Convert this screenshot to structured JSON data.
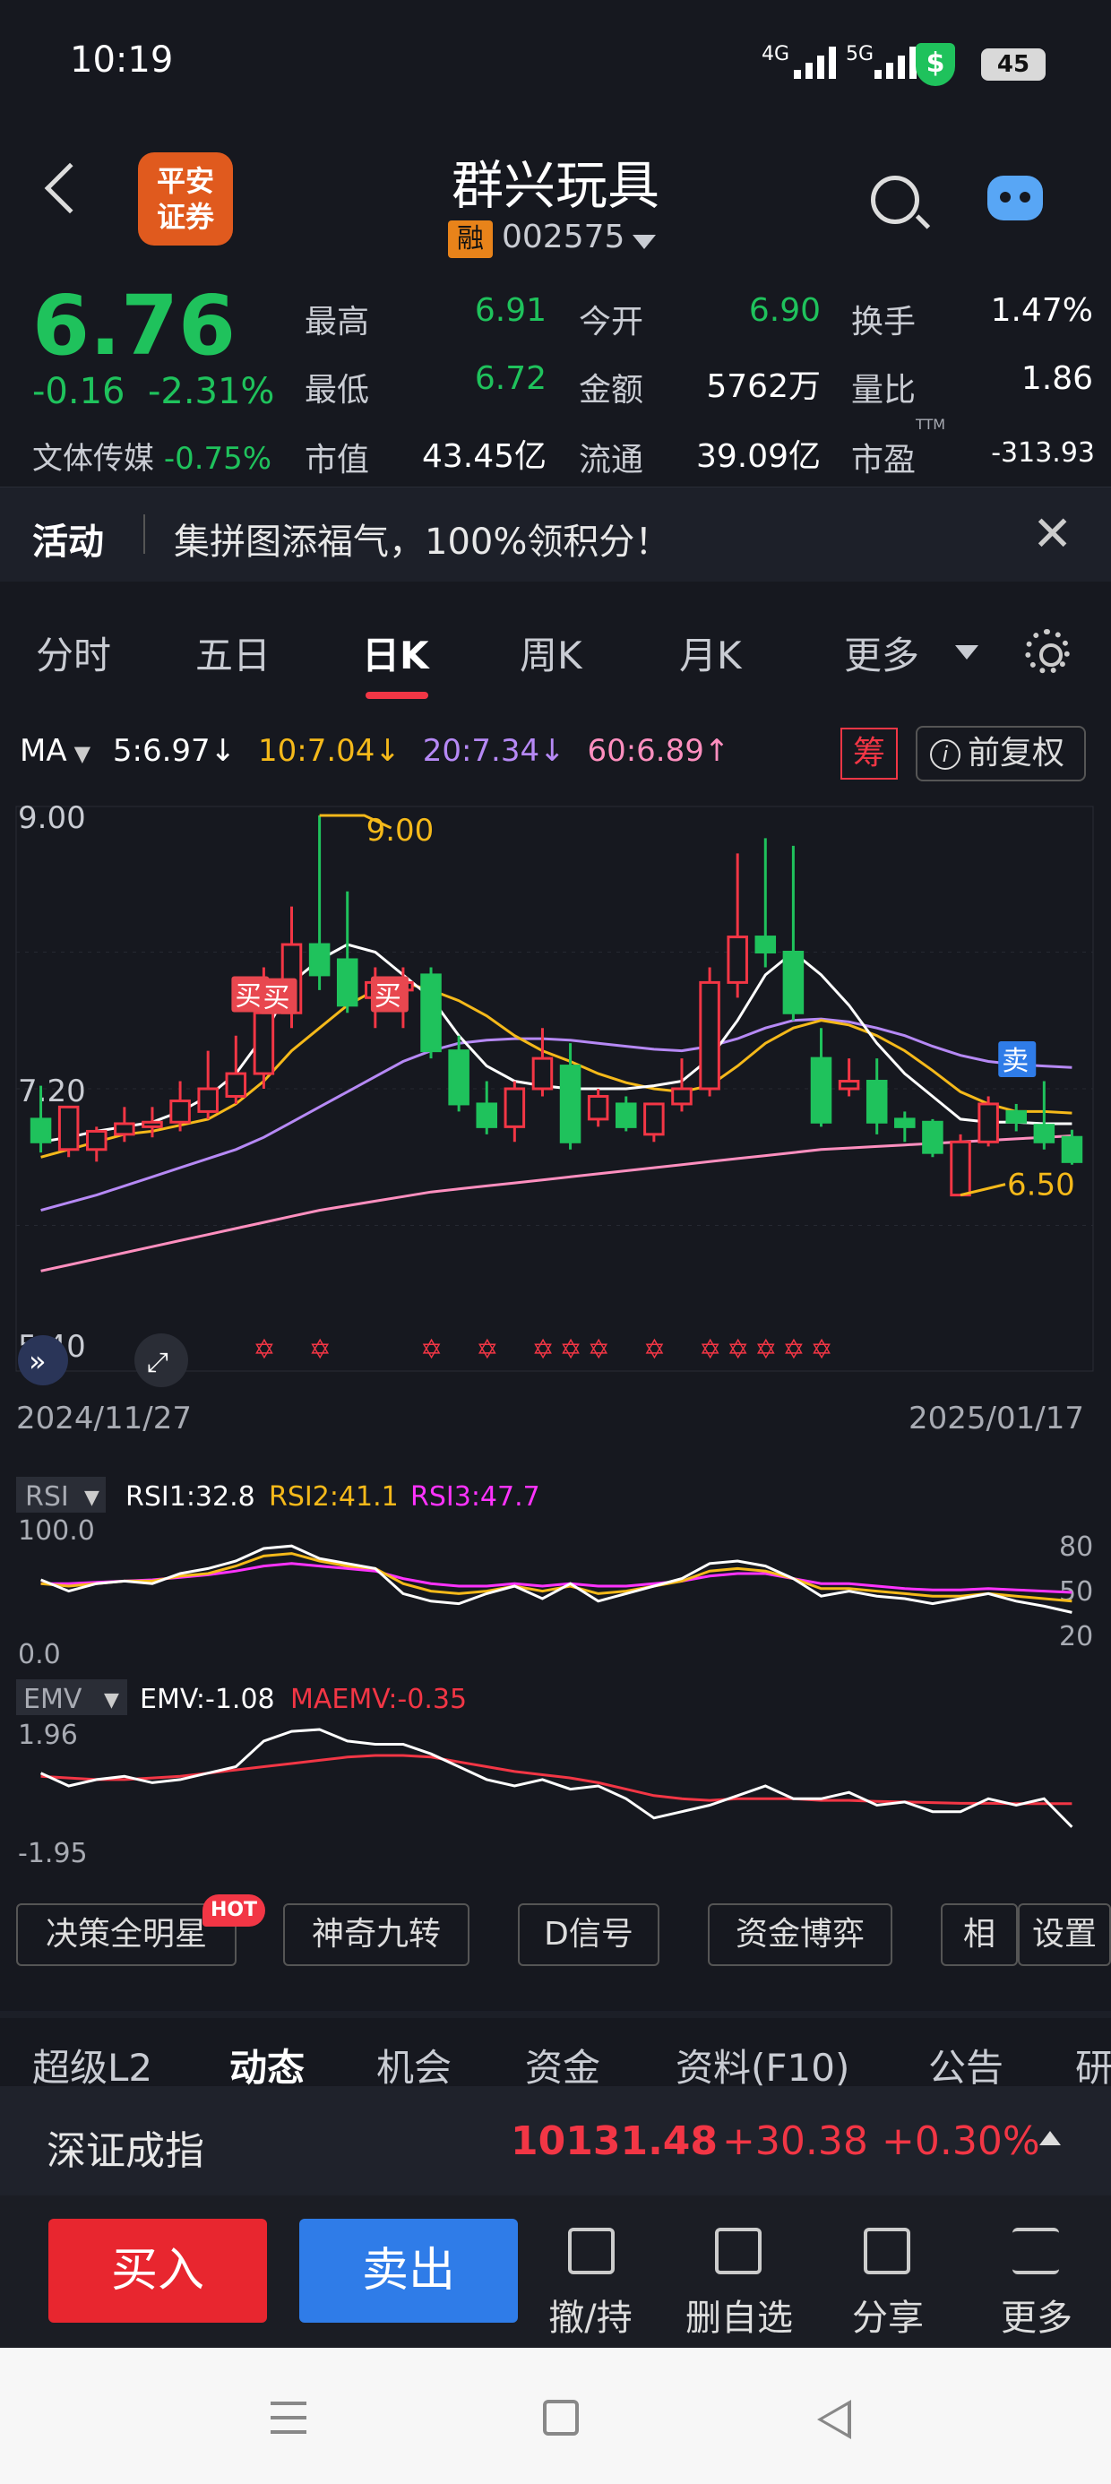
{
  "status_bar": {
    "time": "10:19",
    "net1": "4G",
    "net2": "5G",
    "vpn": "$",
    "battery": "45"
  },
  "header": {
    "logo": "平安\n证券",
    "logo_line1": "平安",
    "logo_line2": "证券",
    "title": "群兴玩具",
    "tag": "融",
    "code": "002575"
  },
  "quote": {
    "price": "6.76",
    "change": "-0.16",
    "change_pct": "-2.31%",
    "sector_label": "文体传媒",
    "sector_pct": "-0.75%",
    "fields": [
      {
        "label": "最高",
        "value": "6.91"
      },
      {
        "label": "今开",
        "value": "6.90"
      },
      {
        "label": "换手",
        "value": "1.47%"
      },
      {
        "label": "最低",
        "value": "6.72"
      },
      {
        "label": "金额",
        "value": "5762万"
      },
      {
        "label": "量比",
        "value": "1.86"
      },
      {
        "label": "市值",
        "value": "43.45亿"
      },
      {
        "label": "流通",
        "value": "39.09亿"
      },
      {
        "label": "市盈",
        "value": "-313.93"
      }
    ],
    "pe_suffix": "TTM"
  },
  "activity": {
    "label": "活动",
    "text": "集拼图添福气，100%领积分！"
  },
  "tabs": [
    "分时",
    "五日",
    "日K",
    "周K",
    "月K",
    "更多"
  ],
  "active_tab": "日K",
  "ma_line": {
    "label": "MA",
    "ma5": "5:6.97↓",
    "ma10": "10:7.04↓",
    "ma20": "20:7.34↓",
    "ma60": "60:6.89↑",
    "chou": "筹",
    "fuquan": "前复权",
    "info_icon": "i"
  },
  "chart_data": {
    "type": "candlestick",
    "y_labels": [
      "9.00",
      "7.20",
      "5.40"
    ],
    "ylim": [
      5.4,
      9.0
    ],
    "x_start": "2024/11/27",
    "x_end": "2025/01/17",
    "high_marker": "9.00",
    "low_marker": "6.50",
    "signals": [
      {
        "label": "买",
        "candle": 8
      },
      {
        "label": "买",
        "candle": 9
      },
      {
        "label": "买",
        "candle": 13
      },
      {
        "label": "卖",
        "candle": 35
      }
    ],
    "star_count": 14,
    "candles": [
      {
        "o": 7.0,
        "h": 7.22,
        "c": 6.85,
        "l": 6.78
      },
      {
        "o": 6.8,
        "h": 7.02,
        "c": 7.08,
        "l": 6.75
      },
      {
        "o": 6.8,
        "h": 6.95,
        "c": 6.92,
        "l": 6.72
      },
      {
        "o": 6.9,
        "h": 7.08,
        "c": 6.97,
        "l": 6.85
      },
      {
        "o": 6.95,
        "h": 7.08,
        "c": 6.98,
        "l": 6.88
      },
      {
        "o": 6.98,
        "h": 7.25,
        "c": 7.12,
        "l": 6.92
      },
      {
        "o": 7.05,
        "h": 7.45,
        "c": 7.2,
        "l": 7.0
      },
      {
        "o": 7.15,
        "h": 7.55,
        "c": 7.3,
        "l": 7.1
      },
      {
        "o": 7.3,
        "h": 8.0,
        "c": 7.7,
        "l": 7.2
      },
      {
        "o": 7.7,
        "h": 8.4,
        "c": 8.15,
        "l": 7.6
      },
      {
        "o": 8.15,
        "h": 9.0,
        "c": 7.95,
        "l": 7.85
      },
      {
        "o": 8.05,
        "h": 8.5,
        "c": 7.75,
        "l": 7.7
      },
      {
        "o": 7.8,
        "h": 8.0,
        "c": 7.9,
        "l": 7.6
      },
      {
        "o": 7.85,
        "h": 8.0,
        "c": 7.9,
        "l": 7.6
      },
      {
        "o": 7.95,
        "h": 8.0,
        "c": 7.45,
        "l": 7.4
      },
      {
        "o": 7.45,
        "h": 7.55,
        "c": 7.1,
        "l": 7.05
      },
      {
        "o": 7.1,
        "h": 7.25,
        "c": 6.95,
        "l": 6.9
      },
      {
        "o": 6.95,
        "h": 7.25,
        "c": 7.2,
        "l": 6.85
      },
      {
        "o": 7.2,
        "h": 7.6,
        "c": 7.4,
        "l": 7.15
      },
      {
        "o": 7.35,
        "h": 7.5,
        "c": 6.85,
        "l": 6.8
      },
      {
        "o": 7.0,
        "h": 7.2,
        "c": 7.15,
        "l": 6.95
      },
      {
        "o": 7.1,
        "h": 7.15,
        "c": 6.95,
        "l": 6.92
      },
      {
        "o": 6.9,
        "h": 7.1,
        "c": 7.1,
        "l": 6.85
      },
      {
        "o": 7.1,
        "h": 7.4,
        "c": 7.2,
        "l": 7.05
      },
      {
        "o": 7.2,
        "h": 8.0,
        "c": 7.9,
        "l": 7.15
      },
      {
        "o": 7.9,
        "h": 8.75,
        "c": 8.2,
        "l": 7.8
      },
      {
        "o": 8.2,
        "h": 8.85,
        "c": 8.1,
        "l": 8.0
      },
      {
        "o": 8.1,
        "h": 8.8,
        "c": 7.7,
        "l": 7.65
      },
      {
        "o": 7.4,
        "h": 7.6,
        "c": 6.98,
        "l": 6.95
      },
      {
        "o": 7.2,
        "h": 7.4,
        "c": 7.25,
        "l": 7.15
      },
      {
        "o": 7.25,
        "h": 7.4,
        "c": 6.98,
        "l": 6.9
      },
      {
        "o": 7.0,
        "h": 7.05,
        "c": 6.95,
        "l": 6.85
      },
      {
        "o": 6.98,
        "h": 7.0,
        "c": 6.78,
        "l": 6.75
      },
      {
        "o": 6.5,
        "h": 6.9,
        "c": 6.85,
        "l": 6.5
      },
      {
        "o": 6.85,
        "h": 7.15,
        "c": 7.1,
        "l": 6.82
      },
      {
        "o": 7.05,
        "h": 7.1,
        "c": 6.98,
        "l": 6.92
      },
      {
        "o": 6.96,
        "h": 7.25,
        "c": 6.85,
        "l": 6.8
      },
      {
        "o": 6.88,
        "h": 6.93,
        "c": 6.72,
        "l": 6.7
      }
    ],
    "ma5": [
      6.85,
      6.88,
      6.92,
      6.95,
      6.98,
      7.05,
      7.15,
      7.3,
      7.55,
      7.9,
      8.05,
      8.15,
      8.1,
      7.95,
      7.8,
      7.55,
      7.35,
      7.25,
      7.22,
      7.2,
      7.2,
      7.2,
      7.22,
      7.25,
      7.4,
      7.65,
      7.95,
      8.1,
      7.95,
      7.75,
      7.5,
      7.3,
      7.15,
      7.0,
      6.98,
      6.98,
      6.97,
      6.97
    ],
    "ma10": [
      6.75,
      6.8,
      6.85,
      6.9,
      6.92,
      6.96,
      7.0,
      7.1,
      7.25,
      7.45,
      7.6,
      7.75,
      7.85,
      7.9,
      7.85,
      7.78,
      7.68,
      7.55,
      7.45,
      7.38,
      7.3,
      7.24,
      7.2,
      7.18,
      7.22,
      7.35,
      7.5,
      7.6,
      7.65,
      7.62,
      7.55,
      7.45,
      7.32,
      7.18,
      7.1,
      7.05,
      7.05,
      7.04
    ],
    "ma20": [
      6.4,
      6.45,
      6.5,
      6.56,
      6.62,
      6.68,
      6.74,
      6.8,
      6.88,
      6.98,
      7.08,
      7.18,
      7.28,
      7.38,
      7.45,
      7.5,
      7.52,
      7.53,
      7.53,
      7.52,
      7.5,
      7.48,
      7.46,
      7.45,
      7.48,
      7.53,
      7.6,
      7.65,
      7.66,
      7.64,
      7.6,
      7.55,
      7.48,
      7.42,
      7.38,
      7.36,
      7.35,
      7.34
    ],
    "ma60": [
      6.0,
      6.04,
      6.08,
      6.12,
      6.16,
      6.2,
      6.24,
      6.28,
      6.32,
      6.36,
      6.4,
      6.43,
      6.46,
      6.49,
      6.52,
      6.54,
      6.56,
      6.58,
      6.6,
      6.62,
      6.64,
      6.66,
      6.68,
      6.7,
      6.72,
      6.74,
      6.76,
      6.78,
      6.8,
      6.81,
      6.82,
      6.83,
      6.84,
      6.85,
      6.86,
      6.87,
      6.88,
      6.89
    ],
    "rsi": {
      "label": "RSI",
      "rsi1": "RSI1:32.8",
      "rsi2": "RSI2:41.1",
      "rsi3": "RSI3:47.7",
      "left_top": "100.0",
      "left_bottom": "0.0",
      "right_levels": [
        "80",
        "50",
        "20"
      ],
      "rsi1_values": [
        55,
        46,
        52,
        54,
        52,
        60,
        64,
        70,
        80,
        82,
        72,
        68,
        64,
        44,
        38,
        36,
        44,
        50,
        40,
        52,
        38,
        44,
        50,
        56,
        68,
        70,
        66,
        56,
        42,
        46,
        42,
        40,
        36,
        40,
        44,
        38,
        34,
        29
      ],
      "rsi2_values": [
        52,
        50,
        52,
        54,
        54,
        58,
        60,
        66,
        74,
        76,
        70,
        66,
        64,
        52,
        46,
        44,
        46,
        50,
        46,
        50,
        44,
        46,
        50,
        54,
        62,
        64,
        62,
        56,
        48,
        48,
        46,
        44,
        42,
        42,
        44,
        42,
        40,
        38
      ],
      "rsi3_values": [
        52,
        52,
        53,
        54,
        55,
        57,
        59,
        62,
        66,
        68,
        66,
        64,
        62,
        56,
        52,
        50,
        50,
        52,
        50,
        52,
        50,
        50,
        52,
        54,
        58,
        60,
        60,
        56,
        52,
        52,
        50,
        48,
        47,
        47,
        48,
        47,
        46,
        45
      ]
    },
    "emv": {
      "label": "EMV",
      "emv_text": "EMV:-1.08",
      "maemv_text": "MAEMV:-0.35",
      "top": "1.96",
      "bottom": "-1.95",
      "emv_values": [
        0.6,
        0.2,
        0.4,
        0.5,
        0.3,
        0.4,
        0.6,
        0.8,
        1.6,
        1.9,
        1.96,
        1.6,
        1.5,
        1.5,
        1.2,
        0.8,
        0.4,
        0.2,
        0.4,
        0.1,
        0.2,
        -0.2,
        -0.8,
        -0.6,
        -0.4,
        -0.1,
        0.2,
        -0.2,
        -0.2,
        0.0,
        -0.4,
        -0.3,
        -0.6,
        -0.6,
        -0.2,
        -0.4,
        -0.2,
        -1.08
      ],
      "maemv_values": [
        0.5,
        0.45,
        0.4,
        0.4,
        0.45,
        0.5,
        0.6,
        0.7,
        0.8,
        0.9,
        1.0,
        1.1,
        1.15,
        1.15,
        1.1,
        0.95,
        0.8,
        0.65,
        0.55,
        0.45,
        0.3,
        0.1,
        -0.1,
        -0.2,
        -0.25,
        -0.2,
        -0.2,
        -0.2,
        -0.25,
        -0.25,
        -0.28,
        -0.3,
        -0.32,
        -0.34,
        -0.34,
        -0.35,
        -0.35,
        -0.35
      ]
    }
  },
  "indicator_buttons": [
    "决策全明星",
    "神奇九转",
    "D信号",
    "资金博弈",
    "相",
    "设置"
  ],
  "hot_badge": "HOT",
  "bottom_tabs": [
    "超级L2",
    "动态",
    "机会",
    "资金",
    "资料(F10)",
    "公告",
    "研"
  ],
  "active_bottom_tab": "动态",
  "index_bar": {
    "name": "深证成指",
    "value": "10131.48",
    "change": "+30.38",
    "pct": "+0.30%"
  },
  "actions": {
    "buy": "买入",
    "sell": "卖出",
    "items": [
      "撤/持",
      "删自选",
      "分享",
      "更多"
    ]
  },
  "colors": {
    "up": "#f23645",
    "down": "#1fc25c",
    "ma5": "#ffffff",
    "ma10": "#f5b91a",
    "ma20": "#b689f5",
    "ma60": "#ff8fbf",
    "background": "#16181f"
  }
}
